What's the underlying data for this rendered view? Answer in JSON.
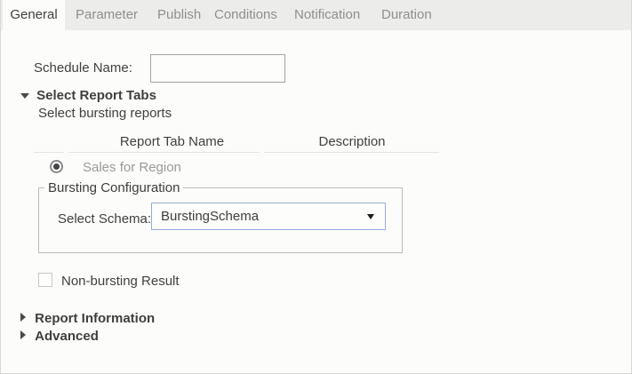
{
  "tabs": {
    "items": [
      {
        "label": "General",
        "active": true
      },
      {
        "label": "Parameter",
        "active": false
      },
      {
        "label": "Publish",
        "active": false
      },
      {
        "label": "Conditions",
        "active": false
      },
      {
        "label": "Notification",
        "active": false
      },
      {
        "label": "Duration",
        "active": false
      }
    ]
  },
  "general": {
    "schedule_name": {
      "label": "Schedule Name:",
      "value": "",
      "placeholder": ""
    },
    "select_report_tabs": {
      "label": "Select Report Tabs",
      "expanded": true,
      "subtitle": "Select bursting reports",
      "table": {
        "columns": [
          "Report Tab Name",
          "Description"
        ],
        "rows": [
          {
            "report_tab_name": "Sales for Region",
            "description": "",
            "selected": true
          }
        ]
      }
    },
    "bursting_configuration": {
      "legend": "Bursting Configuration",
      "select_schema_label": "Select Schema:",
      "selected_schema": "BurstingSchema"
    },
    "non_bursting": {
      "label": "Non-bursting Result",
      "checked": false
    },
    "report_information": {
      "label": "Report Information",
      "expanded": false
    },
    "advanced": {
      "label": "Advanced",
      "expanded": false
    }
  },
  "colors": {
    "content_bg": "#fcfcfa",
    "tabstrip_bg": "#ececea",
    "inactive_tab_text": "#8f8f8f",
    "body_text": "#3f3f3f",
    "muted_text": "#9a9a9a",
    "select_border": "#94aad8",
    "panel_border": "#d9d9d6"
  },
  "icons": {
    "expanded_section": "triangle-down-icon",
    "collapsed_section": "triangle-right-icon",
    "dropdown": "caret-down-icon"
  }
}
